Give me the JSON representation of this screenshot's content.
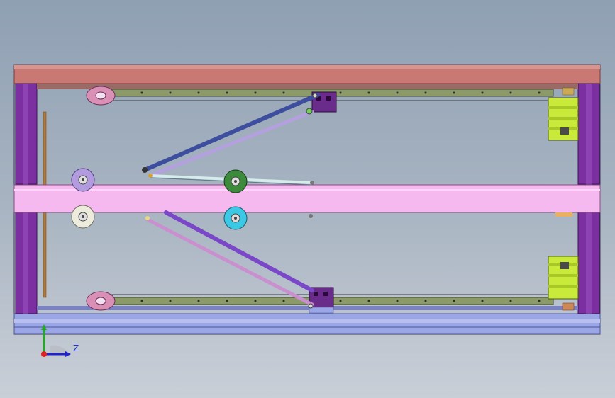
{
  "viewport": {
    "background_top": "#8fa0b3",
    "background_bottom": "#c9cfd7"
  },
  "colors": {
    "top_rail": "#c97873",
    "frame_purple": "#7b2fa0",
    "frame_blue": "#9aa6e6",
    "center_beam": "#f6b9ef",
    "linear_rail": "#8c9a6a",
    "arm_blue": "#3d4e9e",
    "arm_lilac": "#b5a0df",
    "arm_violet": "#7a47c9",
    "arm_pink": "#c98fcf",
    "carriage": "#6a2c8a",
    "motor": "#c9ea3a",
    "pulley_pink": "#d990b4",
    "wheel_green": "#3c8a3c",
    "wheel_cyan": "#3cc9e6",
    "wheel_lilac": "#b39be0",
    "wheel_white": "#ecebdc"
  },
  "icons": {
    "view_triad": "triad-axes-icon"
  },
  "triad": {
    "axis_label": "Z"
  }
}
